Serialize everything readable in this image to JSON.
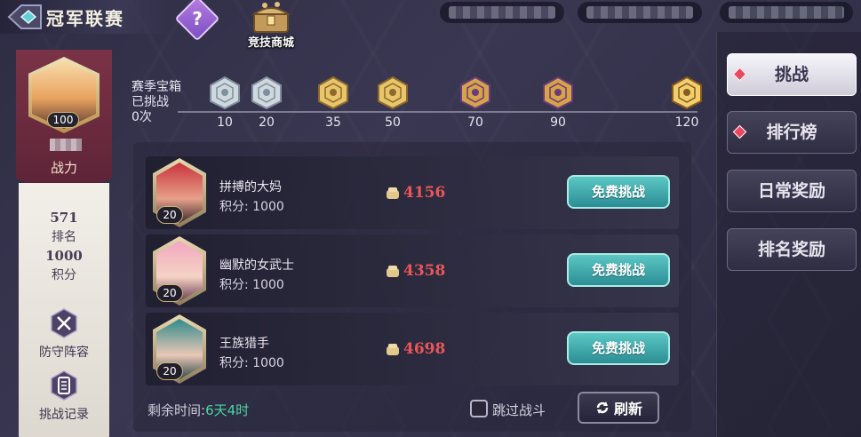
{
  "header": {
    "title": "冠军联赛",
    "help_symbol": "?",
    "shop_label": "竞技商城"
  },
  "player": {
    "level": "100",
    "power_label": "战力",
    "rank_value": "571",
    "rank_label": "排名",
    "score_value": "1000",
    "score_label": "积分",
    "defense_label": "防守阵容",
    "record_label": "挑战记录"
  },
  "season": {
    "chest_label": "赛季宝箱",
    "challenged_label": "已挑战",
    "challenged_count": "0次",
    "milestones": [
      "10",
      "20",
      "35",
      "50",
      "70",
      "90",
      "120"
    ]
  },
  "opponents": [
    {
      "name": "拼搏的大妈",
      "score": "积分: 1000",
      "level": "20",
      "power": "4156",
      "button": "免费挑战"
    },
    {
      "name": "幽默的女武士",
      "score": "积分: 1000",
      "level": "20",
      "power": "4358",
      "button": "免费挑战"
    },
    {
      "name": "王族猎手",
      "score": "积分: 1000",
      "level": "20",
      "power": "4698",
      "button": "免费挑战"
    }
  ],
  "footer": {
    "remaining_label": "剩余时间:",
    "remaining_value": "6天4时",
    "skip_label": "跳过战斗",
    "refresh_label": "刷新"
  },
  "menu": [
    {
      "label": "挑战",
      "active": true,
      "dot": true
    },
    {
      "label": "排行榜",
      "active": false,
      "dot": true
    },
    {
      "label": "日常奖励",
      "active": false,
      "dot": false
    },
    {
      "label": "排名奖励",
      "active": false,
      "dot": false
    }
  ],
  "colors": {
    "accent_teal": "#2b8e95",
    "power_red": "#e8565a",
    "timer_green": "#49d6a6",
    "notify_red": "#e94860"
  },
  "icons": {
    "back": "back-arrow-icon",
    "help": "question-icon",
    "shop": "treasure-chest-icon",
    "power": "fist-icon",
    "defense": "crossed-swords-icon",
    "record": "scroll-icon",
    "refresh": "refresh-icon"
  }
}
